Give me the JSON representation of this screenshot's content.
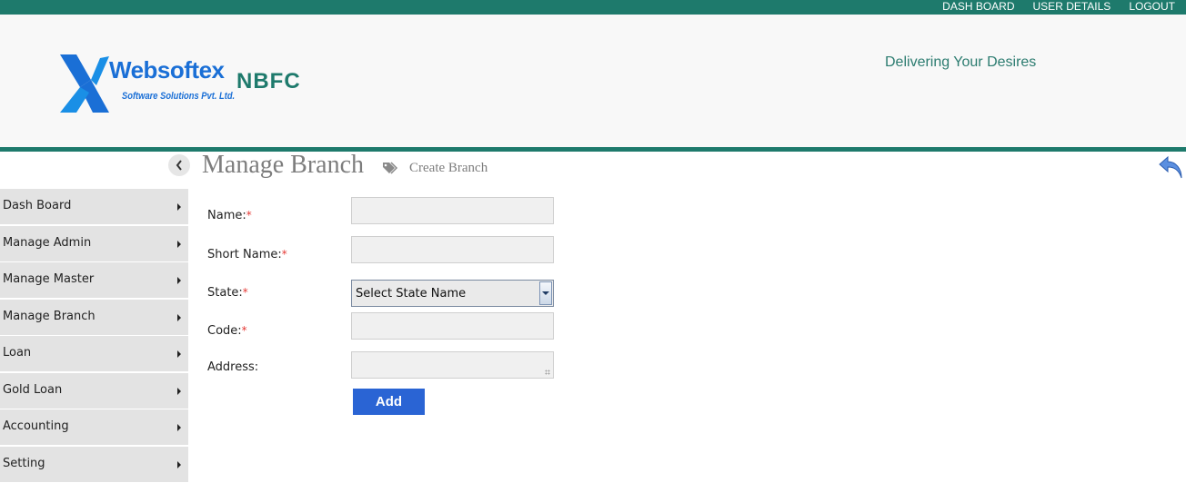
{
  "topnav": {
    "items": [
      {
        "label": "DASH BOARD"
      },
      {
        "label": "USER DETAILS"
      },
      {
        "label": "LOGOUT"
      }
    ]
  },
  "header": {
    "logo_name": "Websoftex",
    "logo_suffix": "NBFC",
    "logo_sub": "Software Solutions Pvt. Ltd.",
    "tagline": "Delivering Your Desires"
  },
  "page": {
    "title": "Manage Branch",
    "subtitle": "Create Branch"
  },
  "sidebar": {
    "items": [
      {
        "label": "Dash Board"
      },
      {
        "label": "Manage Admin"
      },
      {
        "label": "Manage Master"
      },
      {
        "label": "Manage Branch"
      },
      {
        "label": "Loan"
      },
      {
        "label": "Gold Loan"
      },
      {
        "label": "Accounting"
      },
      {
        "label": "Setting"
      }
    ]
  },
  "form": {
    "name_label": "Name:",
    "short_name_label": "Short Name:",
    "state_label": "State:",
    "code_label": "Code:",
    "address_label": "Address:",
    "required_mark": "*",
    "name_value": "",
    "short_name_value": "",
    "state_selected": "Select State Name",
    "code_value": "",
    "address_value": "",
    "add_label": "Add"
  },
  "colors": {
    "brand_teal": "#1e7a6c",
    "logo_blue": "#1a6fd6",
    "button_blue": "#2a64d4",
    "required_red": "#e53935"
  }
}
